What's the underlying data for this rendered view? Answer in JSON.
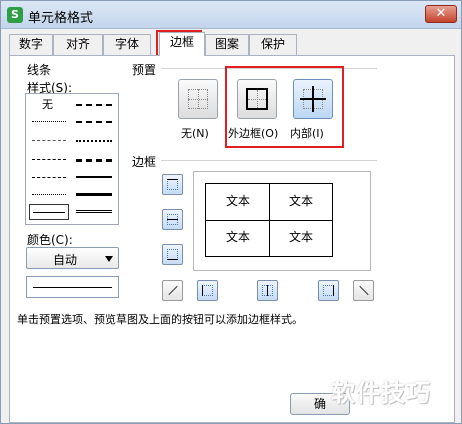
{
  "window": {
    "title": "单元格格式",
    "app_icon": "S",
    "close_glyph": "✕"
  },
  "tabs": [
    {
      "label": "数字"
    },
    {
      "label": "对齐"
    },
    {
      "label": "字体"
    },
    {
      "label": "边框"
    },
    {
      "label": "图案"
    },
    {
      "label": "保护"
    }
  ],
  "active_tab": "边框",
  "line": {
    "group_label": "线条",
    "style_label": "样式(S):",
    "none_label": "无",
    "color_label": "颜色(C):",
    "color_value": "自动"
  },
  "presets": {
    "label": "预置",
    "none": "无(N)",
    "outline": "外边框(O)",
    "inside": "内部(I)"
  },
  "border": {
    "label": "边框",
    "cells": [
      "文本",
      "文本",
      "文本",
      "文本"
    ]
  },
  "hint": "单击预置选项、预览草图及上面的按钮可以添加边框样式。",
  "footer": {
    "ok_label": "确"
  },
  "watermark": "软件技巧",
  "colors": {
    "highlight": "#e02020",
    "accent": "#c4dbf4"
  }
}
